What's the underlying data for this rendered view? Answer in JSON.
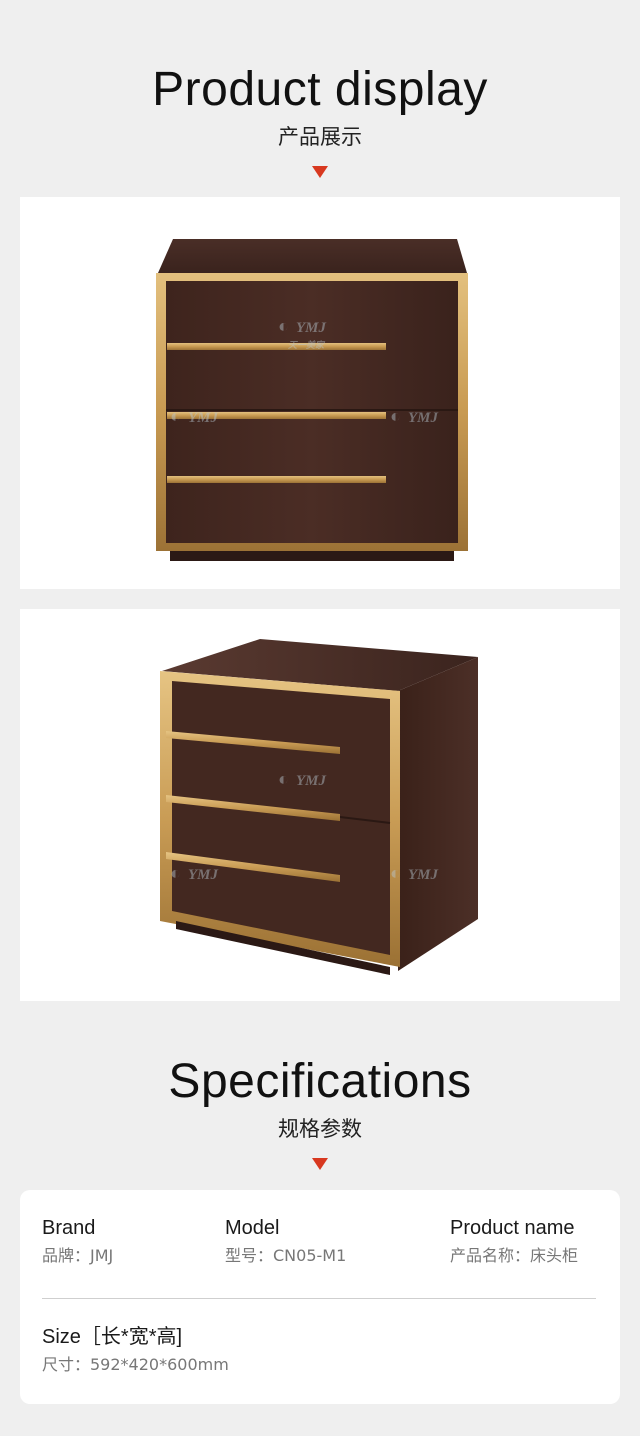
{
  "display_section": {
    "title_en": "Product display",
    "title_cn": "产品展示"
  },
  "watermark": {
    "logo_text": "YMJ",
    "logo_subtext": "天一美家"
  },
  "spec_section": {
    "title_en": "Specifications",
    "title_cn": "规格参数"
  },
  "specs": {
    "brand": {
      "label": "Brand",
      "value": "品牌：JMJ"
    },
    "model": {
      "label": "Model",
      "value": "型号：CN05-M1"
    },
    "product_name": {
      "label": "Product name",
      "value": "产品名称：床头柜"
    },
    "size": {
      "label": "Size［长*宽*高]",
      "value": "尺寸：592*420*600mm"
    }
  },
  "colors": {
    "accent_triangle": "#d8381f",
    "wood_dark": "#3f2620",
    "brass": "#c9a05a"
  }
}
